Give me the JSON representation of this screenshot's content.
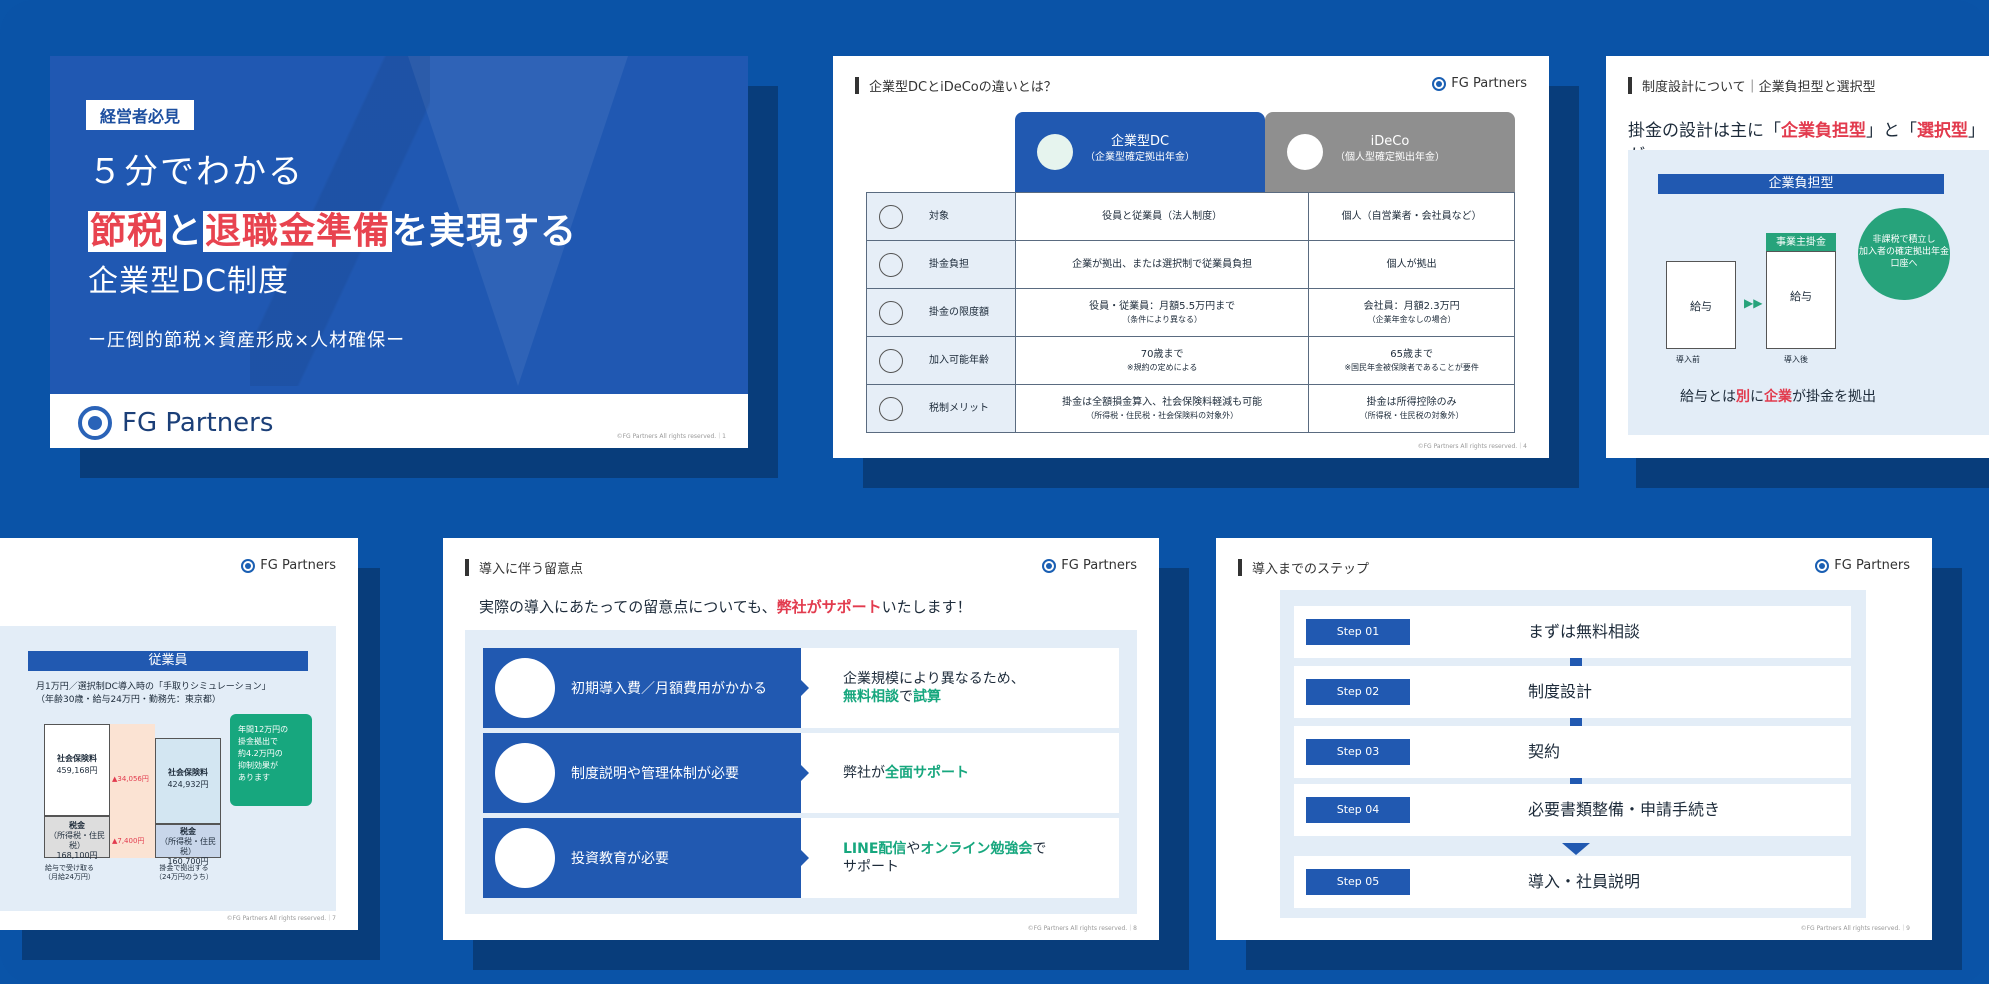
{
  "brand": "FG Partners",
  "copyright": "©FG Partners All rights reserved.",
  "cover": {
    "badge": "経営者必見",
    "line1": "５分でわかる",
    "line2_hl1": "節税",
    "line2_mid": "と",
    "line2_hl2": "退職金準備",
    "line2_end": "を実現する",
    "line3": "企業型DC制度",
    "tagline": "ー圧倒的節税×資産形成×人材確保ー",
    "page": "1"
  },
  "compare": {
    "title": "企業型DCとiDeCoの違いとは？",
    "col1": "企業型DC",
    "col1_sub": "（企業型確定拠出年金）",
    "col2": "iDeCo",
    "col2_sub": "（個人型確定拠出年金）",
    "rows": [
      {
        "label": "対象",
        "c1": "役員と従業員（法人制度）",
        "c1s": "",
        "c2": "個人（自営業者・会社員など）",
        "c2s": ""
      },
      {
        "label": "掛金負担",
        "c1": "企業が拠出、または選択制で従業員負担",
        "c1s": "",
        "c2": "個人が拠出",
        "c2s": ""
      },
      {
        "label": "掛金の限度額",
        "c1": "役員・従業員：月額5.5万円まで",
        "c1s": "（条件により異なる）",
        "c2": "会社員：月額2.3万円",
        "c2s": "（企業年金なしの場合）"
      },
      {
        "label": "加入可能年齢",
        "c1": "70歳まで",
        "c1s": "※規約の定めによる",
        "c2": "65歳まで",
        "c2s": "※国民年金被保険者であることが要件"
      },
      {
        "label": "税制メリット",
        "c1": "掛金は全額損金算入、社会保険料軽減も可能",
        "c1s": "（所得税・住民税・社会保険料の対象外）",
        "c2": "掛金は所得控除のみ",
        "c2s": "（所得税・住民税の対象外）"
      }
    ],
    "page": "4"
  },
  "choice": {
    "title": "制度設計について｜企業負担型と選択型",
    "lead_a": "掛金の設計は主に「",
    "lead_b": "企業負担型",
    "lead_c": "」と「",
    "lead_d": "選択型",
    "lead_e": "」が",
    "panel_title": "企業負担型",
    "box_before": "給与",
    "box_after": "給与",
    "tag": "事業主掛金",
    "bubble_a": "非課税で積立し",
    "bubble_b": "加入者の確定拠出年金口座へ",
    "arrow": "▶▶",
    "sub_before": "導入前",
    "sub_after": "導入後",
    "note_a": "給与とは",
    "note_b": "別",
    "note_c": "に",
    "note_d": "企業",
    "note_e": "が掛金を拠出"
  },
  "sim": {
    "panel_title": "従業員",
    "title_a": "月1万円／選択制DC導入時の「手取りシミュレーション」",
    "title_b": "（年齢30歳・給与24万円・勤務先：東京都）",
    "b1_label": "社会保険料",
    "b1_val": "459,168円",
    "b2_label": "税金",
    "b2_sub": "（所得税・住民税）",
    "b2_val": "168,100円",
    "b3_label": "社会保険料",
    "b3_val": "424,932円",
    "b4_label": "税金",
    "b4_sub": "（所得税・住民税）",
    "b4_val": "160,700円",
    "diff1": "▲34,056円",
    "diff2": "▲7,400円",
    "g1": "年間12万円の",
    "g2": "掛金拠出で",
    "g3": "約4.2万円の",
    "g4": "抑制効果が",
    "g5": "あります",
    "f1a": "給与で受け取る",
    "f1b": "（月給24万円）",
    "f2a": "掛金で拠出する",
    "f2b": "（24万円のうち）",
    "page": "7"
  },
  "notes": {
    "title": "導入に伴う留意点",
    "lead_a": "実際の導入にあたっての留意点についても、",
    "lead_b": "弊社がサポート",
    "lead_c": "いたします！",
    "rows": [
      {
        "l": "初期導入費／月額費用がかかる",
        "r1": "企業規模により異なるため、",
        "r2a": "無料相談",
        "r2b": "で",
        "r2c": "試算"
      },
      {
        "l": "制度説明や管理体制が必要",
        "r1": "",
        "r2a": "弊社が",
        "r2b": "全面サポート",
        "r2c": ""
      },
      {
        "l": "投資教育が必要",
        "r1": "",
        "r2a": "LINE配信",
        "r2b": "や",
        "r2c": "オンライン勉強会"
      }
    ],
    "row3_tail": "で",
    "row3_line2": "サポート",
    "page": "8"
  },
  "steps": {
    "title": "導入までのステップ",
    "items": [
      {
        "step": "Step 01",
        "text": "まずは無料相談"
      },
      {
        "step": "Step 02",
        "text": "制度設計"
      },
      {
        "step": "Step 03",
        "text": "契約"
      },
      {
        "step": "Step 04",
        "text": "必要書類整備・申請手続き"
      },
      {
        "step": "Step 05",
        "text": "導入・社員説明"
      }
    ],
    "page": "9"
  },
  "colors": {
    "background": "#0a53a7",
    "primary": "#2159b1",
    "accent_red": "#e23b4e",
    "accent_green": "#17a77e"
  }
}
